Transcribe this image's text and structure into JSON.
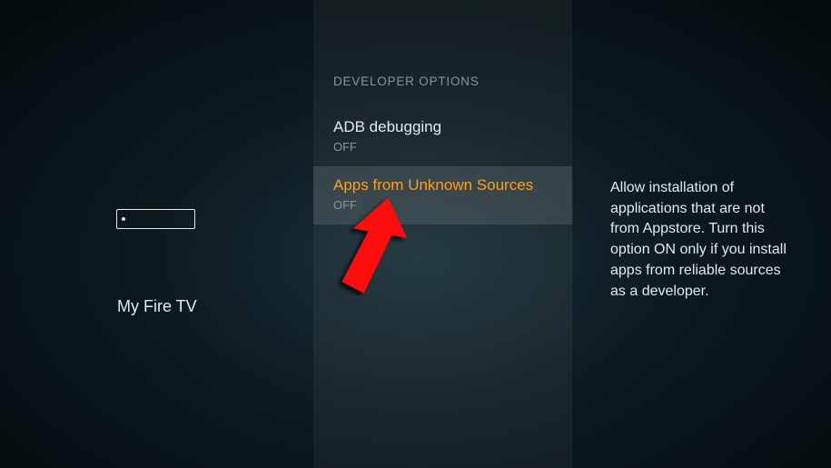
{
  "left": {
    "label": "My Fire TV"
  },
  "settings": {
    "section_title": "DEVELOPER OPTIONS",
    "options": [
      {
        "label": "ADB debugging",
        "status": "OFF"
      },
      {
        "label": "Apps from Unknown Sources",
        "status": "OFF"
      }
    ]
  },
  "right": {
    "description": "Allow installation of applications that are not from Appstore. Turn this option ON only if you install apps from reliable sources as a developer."
  }
}
